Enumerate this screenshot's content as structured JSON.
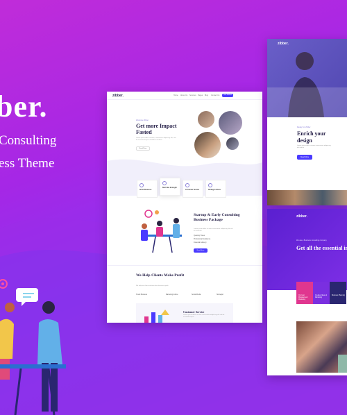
{
  "hero": {
    "brand": "ber.",
    "tagline_line1": "Consulting",
    "tagline_line2": "ess Theme"
  },
  "main_mockup": {
    "logo": "zibber.",
    "nav_items": [
      "Home",
      "About Us",
      "Services",
      "Pages",
      "Blog",
      "Contact Us"
    ],
    "nav_cta": "Get Started",
    "hero_tag": "Welcome Zibber",
    "hero_title": "Get more Impact Fasted",
    "hero_desc": "Lorem ipsum dolor sit amet, consectetur adipiscing elit, sed do eiusmod tempor incididunt ut labore",
    "hero_button": "Read More",
    "features": [
      "Smart Business",
      "Best Idea & Insight",
      "Consumer Service",
      "Strategic Advice"
    ],
    "section2_title": "Startup & Early Consulting Business Package",
    "section2_desc": "Lorem ipsum dolor sit amet consectetur adipiscing elit sed do eiusmod",
    "section2_checks": [
      "Quarterly Taxes",
      "Professional Assistance",
      "Financial Advisory"
    ],
    "section2_button": "Read More",
    "section3_title": "We Help Clients Make Profit",
    "section3_desc": "We help our clients achieve their business goals",
    "section3_tabs": [
      "Smart Business",
      "Marketing Advice",
      "Social Media",
      "Strategist"
    ],
    "cs_title": "Customer Service",
    "cs_desc": "Lorem ipsum dolor sit amet consectetur adipiscing elit sed do eiusmod tempor"
  },
  "right_mockup_1": {
    "logo": "zibber.",
    "tag": "Ready For Zibber",
    "title": "Enrich your design",
    "desc": "Lorem ipsum dolor sit amet consectetur adipiscing elit sed do",
    "button": "Read More"
  },
  "right_mockup_2": {
    "logo": "zibber.",
    "tag": "We are a Business consulting company",
    "title": "Get all the essential in a lightweight pa",
    "cards": [
      "Our best Management Marketing",
      "Creative Ideas & Marketing",
      "Business Planning"
    ]
  },
  "colors": {
    "accent": "#4a3aff",
    "bg_magenta": "#c02cd9",
    "bg_purple": "#8a34f0",
    "card_pink": "#e0368f",
    "card_violet": "#7a2fe0",
    "card_navy": "#2a2670"
  }
}
